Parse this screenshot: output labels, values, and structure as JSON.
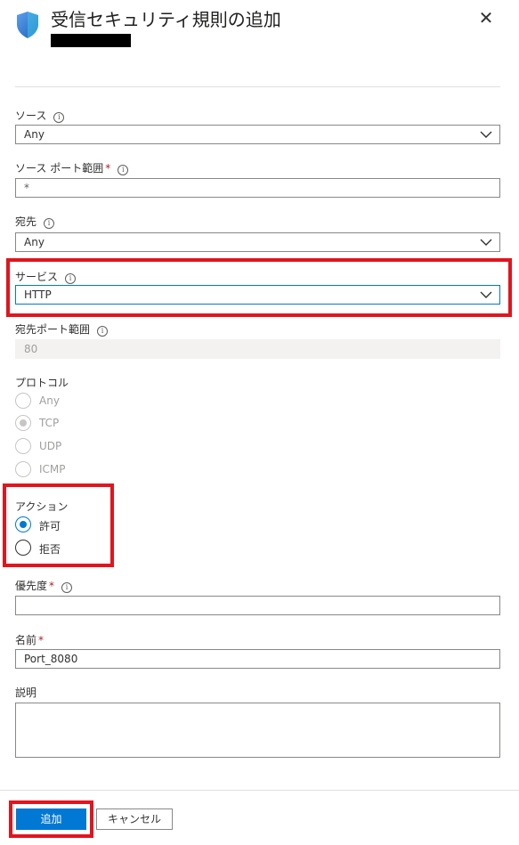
{
  "header": {
    "title": "受信セキュリティ規則の追加",
    "close_icon": "close-icon",
    "shield_icon": "shield-icon"
  },
  "source": {
    "label": "ソース",
    "value": "Any"
  },
  "source_port": {
    "label": "ソース ポート範囲",
    "required": "*",
    "value": "*"
  },
  "destination": {
    "label": "宛先",
    "value": "Any"
  },
  "service": {
    "label": "サービス",
    "value": "HTTP"
  },
  "dest_port": {
    "label": "宛先ポート範囲",
    "value": "80"
  },
  "protocol": {
    "label": "プロトコル",
    "options": [
      "Any",
      "TCP",
      "UDP",
      "ICMP"
    ],
    "selected": "TCP"
  },
  "action": {
    "label": "アクション",
    "options": [
      "許可",
      "拒否"
    ],
    "selected": "許可"
  },
  "priority": {
    "label": "優先度",
    "required": "*",
    "value": ""
  },
  "name": {
    "label": "名前",
    "required": "*",
    "value": "Port_8080"
  },
  "description": {
    "label": "説明",
    "value": ""
  },
  "footer": {
    "add_label": "追加",
    "cancel_label": "キャンセル"
  },
  "colors": {
    "accent": "#0078d4",
    "highlight": "#e3141d",
    "required": "#a4262c"
  }
}
